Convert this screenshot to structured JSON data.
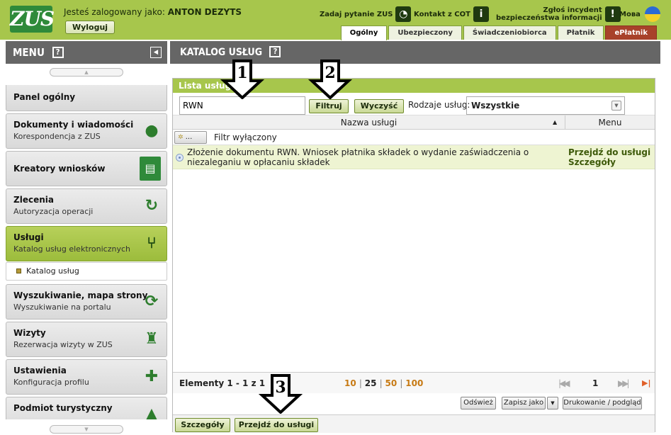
{
  "header": {
    "logo_text": "ZUS",
    "logged_in_label": "Jesteś zalogowany jako:",
    "user_name": "ANTON DEZYTS",
    "logout_label": "Wyloguj",
    "ask_question": "Zadaj pytanie ZUS",
    "contact_cot": "Kontakt z COT",
    "report_incident_1": "Zgłoś incydent",
    "report_incident_2": "bezpieczeństwa informacji",
    "language_label": "Мова",
    "tabs": [
      {
        "label": "Ogólny",
        "active": true
      },
      {
        "label": "Ubezpieczony"
      },
      {
        "label": "Świadczeniobiorca"
      },
      {
        "label": "Płatnik"
      },
      {
        "label": "ePłatnik"
      }
    ]
  },
  "sidebar": {
    "title": "MENU",
    "help_icon": "?",
    "items": [
      {
        "title": "Panel ogólny",
        "subtitle": "",
        "icon": "none"
      },
      {
        "title": "Dokumenty i wiadomości",
        "subtitle": "Korespondencja z ZUS",
        "icon": "speech-bubble-icon"
      },
      {
        "title": "Kreatory wniosków",
        "subtitle": "",
        "icon": "form-wizard-icon"
      },
      {
        "title": "Zlecenia",
        "subtitle": "Autoryzacja operacji",
        "icon": "refresh-icon"
      },
      {
        "title": "Usługi",
        "subtitle": "Katalog usług elektronicznych",
        "icon": "services-icon",
        "active": true
      },
      {
        "title": "Wyszukiwanie, mapa strony",
        "subtitle": "Wyszukiwanie na portalu",
        "icon": "sync-icon"
      },
      {
        "title": "Wizyty",
        "subtitle": "Rezerwacja wizyty w ZUS",
        "icon": "walking-person-icon"
      },
      {
        "title": "Ustawienia",
        "subtitle": "Konfiguracja profilu",
        "icon": "puzzle-icon"
      },
      {
        "title": "Podmiot turystyczny",
        "subtitle": "",
        "icon": "tourism-icon"
      }
    ],
    "sub_item": "Katalog usług"
  },
  "main": {
    "title": "KATALOG USŁUG",
    "panel_title": "Lista usług",
    "search_value": "RWN",
    "filter_button": "Filtruj",
    "clear_button": "Wyczyść",
    "kind_label": "Rodzaje usług:",
    "kind_value": "Wszystkie",
    "col_name": "Nazwa usługi",
    "col_menu": "Menu",
    "filter_toggle": "...",
    "filter_status": "Filtr wyłączony",
    "rows": [
      {
        "name": "Złożenie dokumentu RWN. Wniosek płatnika składek o wydanie zaświadczenia o niezaleganiu w opłacaniu składek",
        "menu_1": "Przejdź do usługi",
        "menu_2": "Szczegóły"
      }
    ],
    "pager": {
      "count": "Elementy 1 - 1 z 1",
      "sizes": [
        "10",
        "25",
        "50",
        "100"
      ],
      "current_size": "25",
      "current_page": "1"
    },
    "refresh_button": "Odśwież",
    "save_as_button": "Zapisz jako",
    "print_button": "Drukowanie / podgląd",
    "details_button": "Szczegóły",
    "go_button": "Przejdź do usługi"
  },
  "annotations": [
    "1",
    "2",
    "3"
  ],
  "colors": {
    "brand_green": "#a7c64c",
    "dark_green": "#2f8a3a",
    "header_gray": "#666666",
    "eplatnik_red": "#a8422a",
    "row_highlight": "#eef4d2"
  }
}
